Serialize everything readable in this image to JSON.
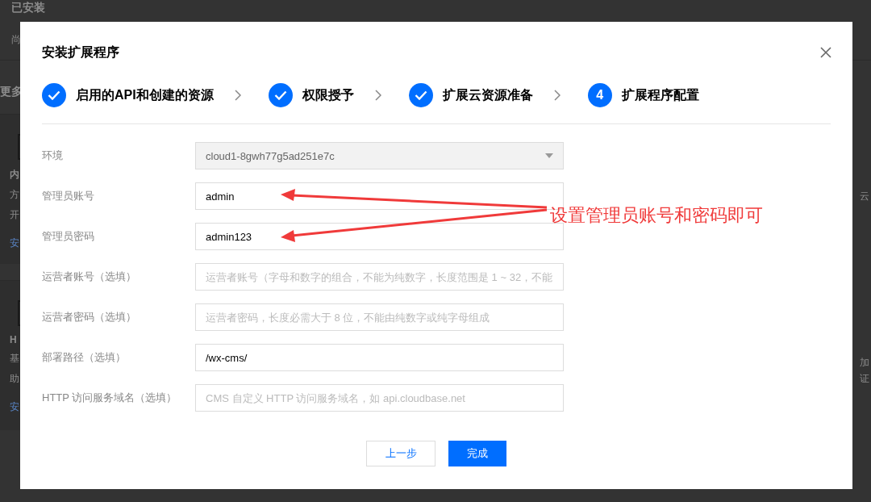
{
  "backdrop": {
    "heading": "已安装",
    "note": "尚",
    "section": "更多",
    "left_fragments": [
      [
        "内",
        "方",
        "开",
        "安"
      ],
      [
        "H",
        "基",
        "助",
        "安"
      ]
    ],
    "right_fragments": [
      [
        "云"
      ],
      [
        "加",
        "证"
      ]
    ]
  },
  "dialog": {
    "title": "安装扩展程序",
    "steps": [
      {
        "label": "启用的API和创建的资源",
        "done": true
      },
      {
        "label": "权限授予",
        "done": true
      },
      {
        "label": "扩展云资源准备",
        "done": true
      },
      {
        "label": "扩展程序配置",
        "done": false,
        "number": "4"
      }
    ],
    "fields": [
      {
        "label": "环境",
        "kind": "select",
        "disabled": true,
        "value": "cloud1-8gwh77g5ad251e7c"
      },
      {
        "label": "管理员账号",
        "kind": "input",
        "disabled": false,
        "value": "admin"
      },
      {
        "label": "管理员密码",
        "kind": "input",
        "disabled": false,
        "value": "admin123"
      },
      {
        "label": "运营者账号（选填）",
        "kind": "input",
        "disabled": false,
        "placeholder": "运营者账号（字母和数字的组合，不能为纯数字，长度范围是 1 ~ 32，不能"
      },
      {
        "label": "运营者密码（选填）",
        "kind": "input",
        "disabled": false,
        "placeholder": "运营者密码，长度必需大于 8 位，不能由纯数字或纯字母组成"
      },
      {
        "label": "部署路径（选填）",
        "kind": "input",
        "disabled": false,
        "value": "/wx-cms/"
      },
      {
        "label": "HTTP 访问服务域名（选填）",
        "kind": "input",
        "disabled": false,
        "placeholder": "CMS 自定义 HTTP 访问服务域名，如 api.cloudbase.net"
      }
    ],
    "buttons": [
      {
        "label": "上一步",
        "kind": "secondary"
      },
      {
        "label": "完成",
        "kind": "primary"
      }
    ]
  },
  "annotation": {
    "text": "设置管理员账号和密码即可"
  }
}
